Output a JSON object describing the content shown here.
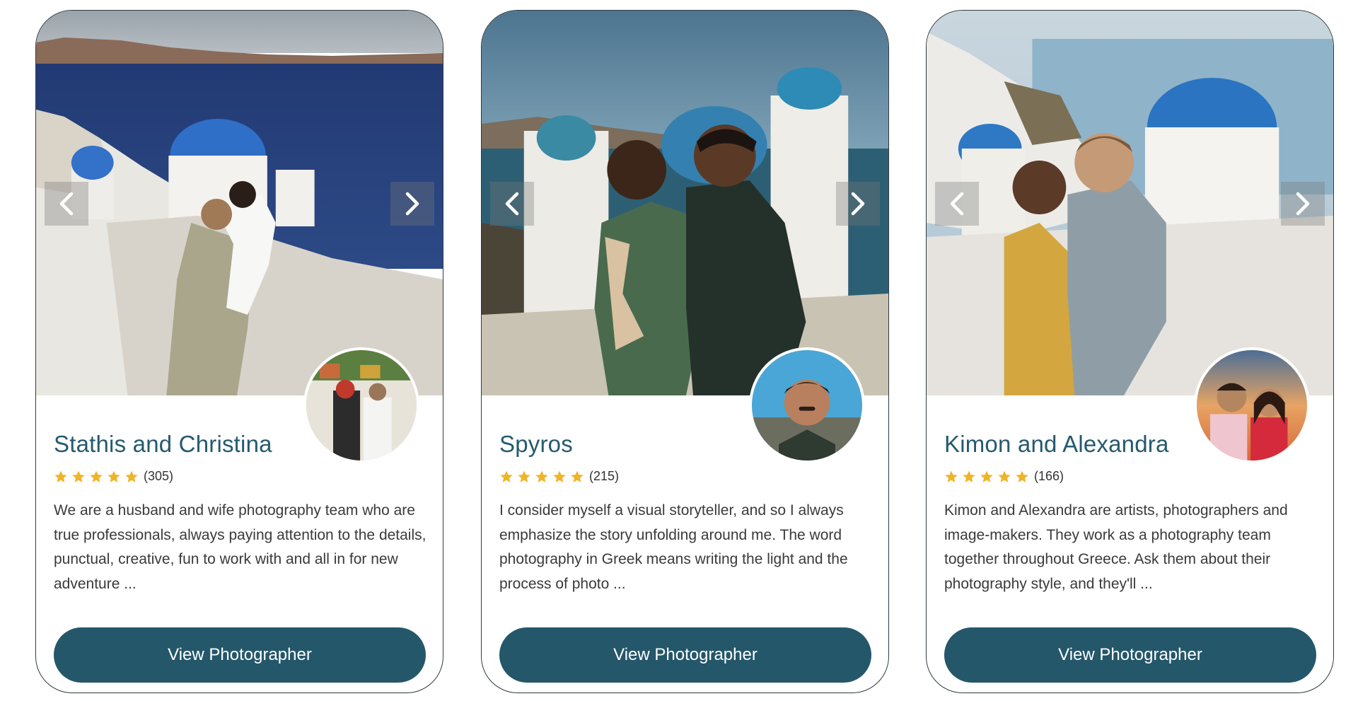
{
  "colors": {
    "accent": "#24576a",
    "name_text": "#255a6e",
    "star": "#f0b429",
    "body_text": "#3a3a3a"
  },
  "cards": [
    {
      "name": "Stathis and Christina",
      "rating_stars": 5,
      "review_count": "(305)",
      "description": "We are a husband and wife photography team who are true professionals, always paying attention to the details, punctual, creative, fun to work with and all in for new adventure ...",
      "button_label": "View Photographer"
    },
    {
      "name": "Spyros",
      "rating_stars": 5,
      "review_count": "(215)",
      "description": "I consider myself a visual storyteller, and so I always emphasize the story unfolding around me. The word photography in Greek means writing the light and the process of photo ...",
      "button_label": "View Photographer"
    },
    {
      "name": "Kimon and Alexandra",
      "rating_stars": 5,
      "review_count": "(166)",
      "description": "Kimon and Alexandra are artists, photographers and image-makers. They work as a photography team together throughout Greece. Ask them about their photography style, and they'll ...",
      "button_label": "View Photographer"
    }
  ],
  "icons": {
    "prev": "chevron-left-icon",
    "next": "chevron-right-icon",
    "star": "star-icon"
  }
}
